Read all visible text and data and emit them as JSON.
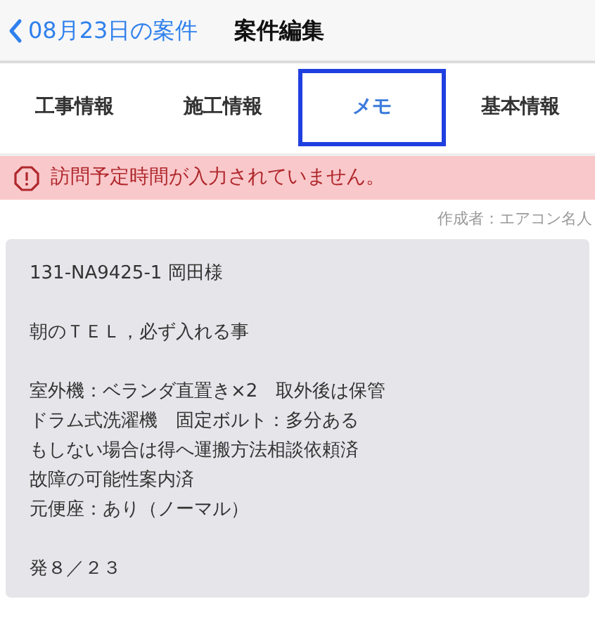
{
  "navbar": {
    "back_label": "08月23日の案件",
    "title": "案件編集"
  },
  "tabs": [
    {
      "label": "工事情報",
      "selected": false,
      "highlighted": false
    },
    {
      "label": "施工情報",
      "selected": false,
      "highlighted": false
    },
    {
      "label": "メモ",
      "selected": true,
      "highlighted": true
    },
    {
      "label": "基本情報",
      "selected": false,
      "highlighted": false
    }
  ],
  "alert": {
    "message": "訪問予定時間が入力されていません。"
  },
  "author": "作成者：エアコン名人",
  "memo": [
    [
      "131-NA9425-1 岡田様"
    ],
    [
      "朝のＴＥＬ，必ず入れる事"
    ],
    [
      "室外機：ベランダ直置き×2　取外後は保管",
      "ドラム式洗濯機　固定ボルト：多分ある",
      "もしない場合は得へ運搬方法相談依頼済",
      "故障の可能性案内済",
      "元便座：あり（ノーマル）"
    ],
    [
      "発８／２３"
    ]
  ]
}
